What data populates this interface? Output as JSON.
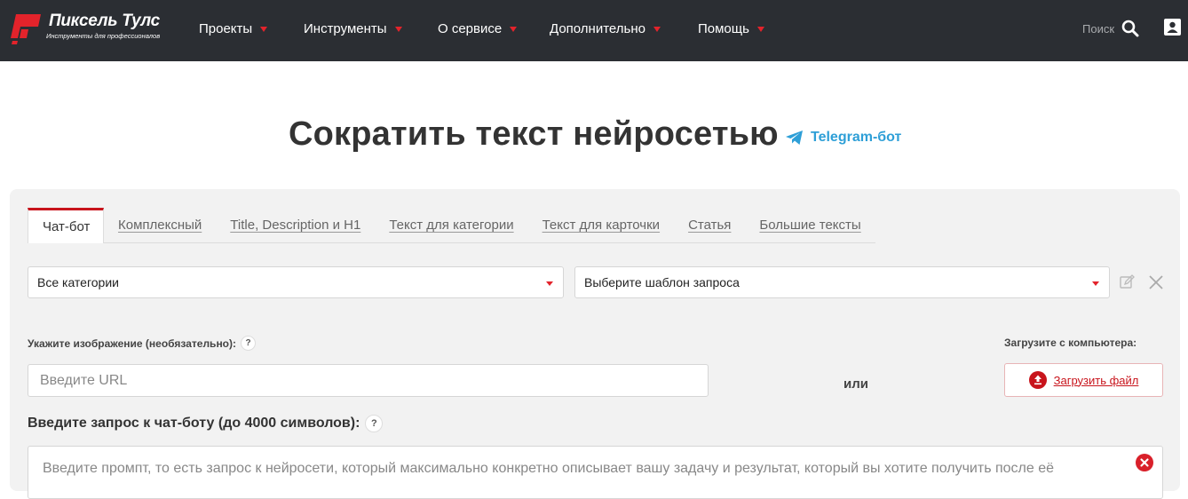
{
  "header": {
    "logo_title": "Пиксель Тулс",
    "logo_subtitle": "Инструменты для профессионалов",
    "nav": [
      {
        "label": "Проекты"
      },
      {
        "label": "Инструменты"
      },
      {
        "label": "О сервисе"
      },
      {
        "label": "Дополнительно"
      },
      {
        "label": "Помощь"
      }
    ],
    "search_label": "Поиск"
  },
  "page": {
    "title": "Сократить текст нейросетью",
    "telegram_link": "Telegram-бот"
  },
  "tabs": [
    {
      "label": "Чат-бот",
      "active": true
    },
    {
      "label": "Комплексный"
    },
    {
      "label": "Title, Description и H1"
    },
    {
      "label": "Текст для категории"
    },
    {
      "label": "Текст для карточки"
    },
    {
      "label": "Статья"
    },
    {
      "label": "Большие тексты"
    }
  ],
  "filters": {
    "category_value": "Все категории",
    "template_value": "Выберите шаблон запроса"
  },
  "image": {
    "label": "Укажите изображение (необязательно):",
    "url_placeholder": "Введите URL",
    "or_text": "или",
    "upload_label": "Загрузите с компьютера:",
    "upload_button": "Загрузить файл"
  },
  "prompt": {
    "label": "Введите запрос к чат-боту (до 4000 символов):",
    "placeholder": "Введите промпт, то есть запрос к нейросети, который максимально конкретно описывает вашу задачу и результат, который вы хотите получить после её"
  },
  "help_mark": "?",
  "colors": {
    "header_bg": "#2b2e33",
    "accent_red": "#e3232b",
    "telegram_blue": "#2e9fd7",
    "panel_bg": "#f2f2f2"
  }
}
